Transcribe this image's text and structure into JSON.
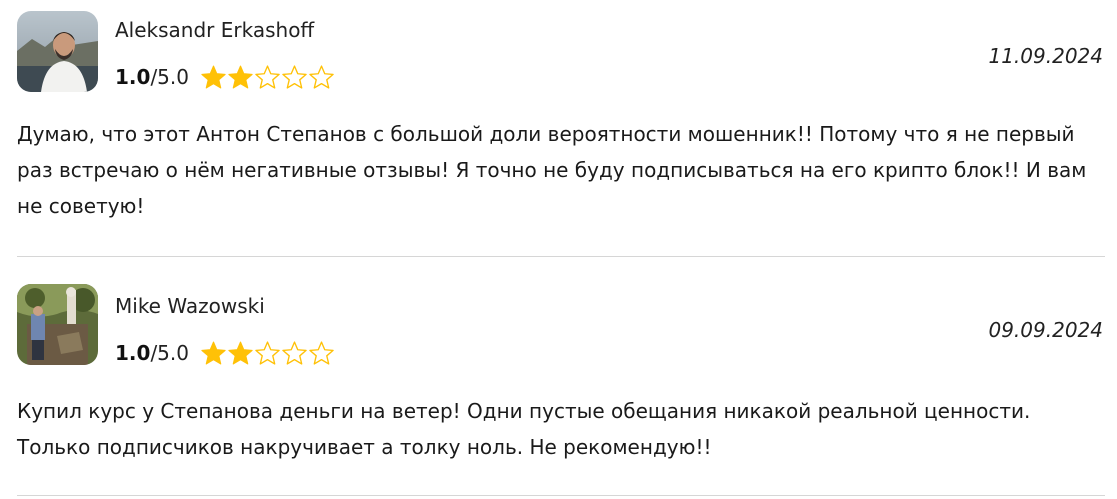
{
  "reviews": [
    {
      "author": "Aleksandr Erkashoff",
      "score": "1.0",
      "score_max": "/5.0",
      "stars_filled": 2,
      "stars_total": 5,
      "date": "11.09.2024",
      "text": "Думаю, что этот Антон Степанов с большой доли вероятности мошенник!! Потому что я не первый раз встречаю о нём негативные отзывы! Я точно не буду подписываться на его крипто блок!! И вам не советую!"
    },
    {
      "author": "Mike Wazowski",
      "score": "1.0",
      "score_max": "/5.0",
      "stars_filled": 2,
      "stars_total": 5,
      "date": "09.09.2024",
      "text": "Купил курс у Степанова деньги на ветер! Одни пустые обещания никакой реальной ценности. Только подписчиков накручивает а толку ноль. Не рекомендую!!"
    }
  ],
  "colors": {
    "star_fill": "#FFC107",
    "star_outline": "#FFC107",
    "divider": "#d6d6d6"
  }
}
